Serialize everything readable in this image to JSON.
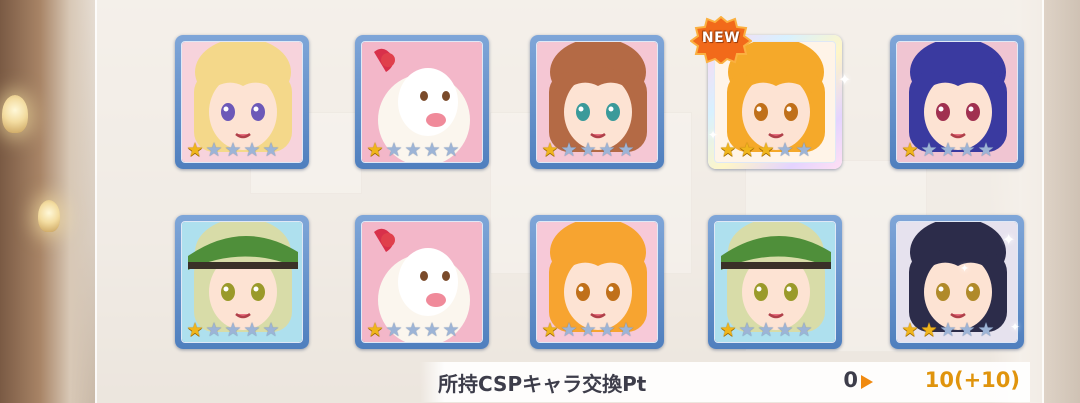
{
  "screen": "gacha-results",
  "new_badge_label": "NEW",
  "cards": [
    {
      "id": "char-blonde-elf",
      "stars": 1,
      "max_stars": 5,
      "is_new": false,
      "hair": "#f4d88a",
      "skin": "#fde3d3",
      "bg": "#f7d3dc",
      "eyes": "#6c58b8"
    },
    {
      "id": "char-alpaca",
      "stars": 1,
      "max_stars": 5,
      "is_new": false,
      "hair": "#f6efe6",
      "skin": "#f6efe6",
      "bg": "#f3b7c9",
      "eyes": "#7a4a2a"
    },
    {
      "id": "char-brown-hair",
      "stars": 1,
      "max_stars": 5,
      "is_new": false,
      "hair": "#b46a45",
      "skin": "#fde3d3",
      "bg": "#f5c7d4",
      "eyes": "#3a9a9a"
    },
    {
      "id": "char-orange-hair",
      "stars": 3,
      "max_stars": 5,
      "is_new": true,
      "hair": "#f5a92a",
      "skin": "#fde3d3",
      "bg": "#fff4e8",
      "eyes": "#c0701a"
    },
    {
      "id": "char-purple-hair",
      "stars": 1,
      "max_stars": 5,
      "is_new": false,
      "hair": "#3a3aa0",
      "skin": "#fde3d3",
      "bg": "#f0c5d2",
      "eyes": "#a03050"
    },
    {
      "id": "char-green-hat-elf",
      "stars": 1,
      "max_stars": 5,
      "is_new": false,
      "hair": "#d8dca8",
      "skin": "#fde3d3",
      "bg": "#aee0ee",
      "eyes": "#9a9a2a"
    },
    {
      "id": "char-alpaca",
      "stars": 1,
      "max_stars": 5,
      "is_new": false,
      "hair": "#f6efe6",
      "skin": "#f6efe6",
      "bg": "#f3b7c9",
      "eyes": "#7a4a2a"
    },
    {
      "id": "char-orange-catgirl",
      "stars": 1,
      "max_stars": 5,
      "is_new": false,
      "hair": "#f7a430",
      "skin": "#fde3d3",
      "bg": "#f7c9d8",
      "eyes": "#c0701a"
    },
    {
      "id": "char-green-hat-elf",
      "stars": 1,
      "max_stars": 5,
      "is_new": false,
      "hair": "#d8dca8",
      "skin": "#fde3d3",
      "bg": "#aee0ee",
      "eyes": "#9a9a2a"
    },
    {
      "id": "char-dark-hair",
      "stars": 2,
      "max_stars": 5,
      "is_new": false,
      "hair": "#2c2c4a",
      "skin": "#fde3d3",
      "bg": "#e6e2ee",
      "eyes": "#b08a2a"
    }
  ],
  "points": {
    "label": "所持CSPキャラ交換Pt",
    "before": "0",
    "after": "10(+10)",
    "after_color": "#e0940c"
  },
  "colors": {
    "frame": "#5b88c4",
    "star_on": "#f0b51c",
    "star_off": "#9db4d6"
  }
}
